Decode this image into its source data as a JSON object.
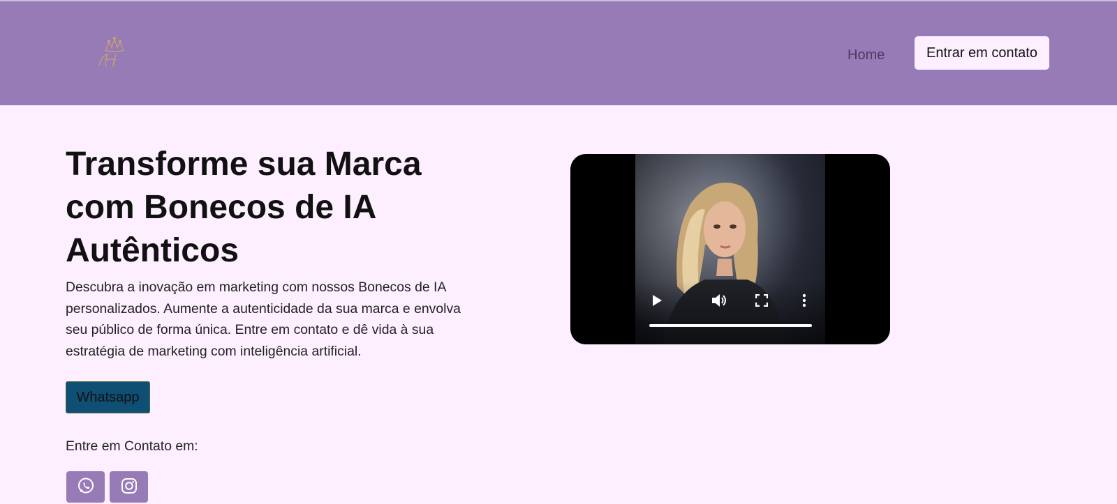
{
  "header": {
    "logo_icon": "crown-monogram-logo",
    "nav": {
      "home_label": "Home"
    },
    "contact_button_label": "Entrar em contato"
  },
  "hero": {
    "title": "Transforme sua Marca com Bonecos de IA Autênticos",
    "description": "Descubra a inovação em marketing com nossos Bonecos de IA personalizados. Aumente a autenticidade da sua marca e envolva seu público de forma única. Entre em contato e dê vida à sua estratégia de marketing com inteligência artificial.",
    "whatsapp_button_label": "Whatsapp",
    "contact_label": "Entre em Contato em:",
    "social_icons": [
      "whatsapp-icon",
      "instagram-icon"
    ]
  },
  "video": {
    "controls": [
      "play-icon",
      "volume-icon",
      "fullscreen-icon",
      "more-options-icon"
    ],
    "progress": 0
  },
  "colors": {
    "header_bg": "#977bb7",
    "page_bg": "#fdefff",
    "whatsapp_button_bg": "#0e4f73",
    "social_button_bg": "#977bb7"
  }
}
